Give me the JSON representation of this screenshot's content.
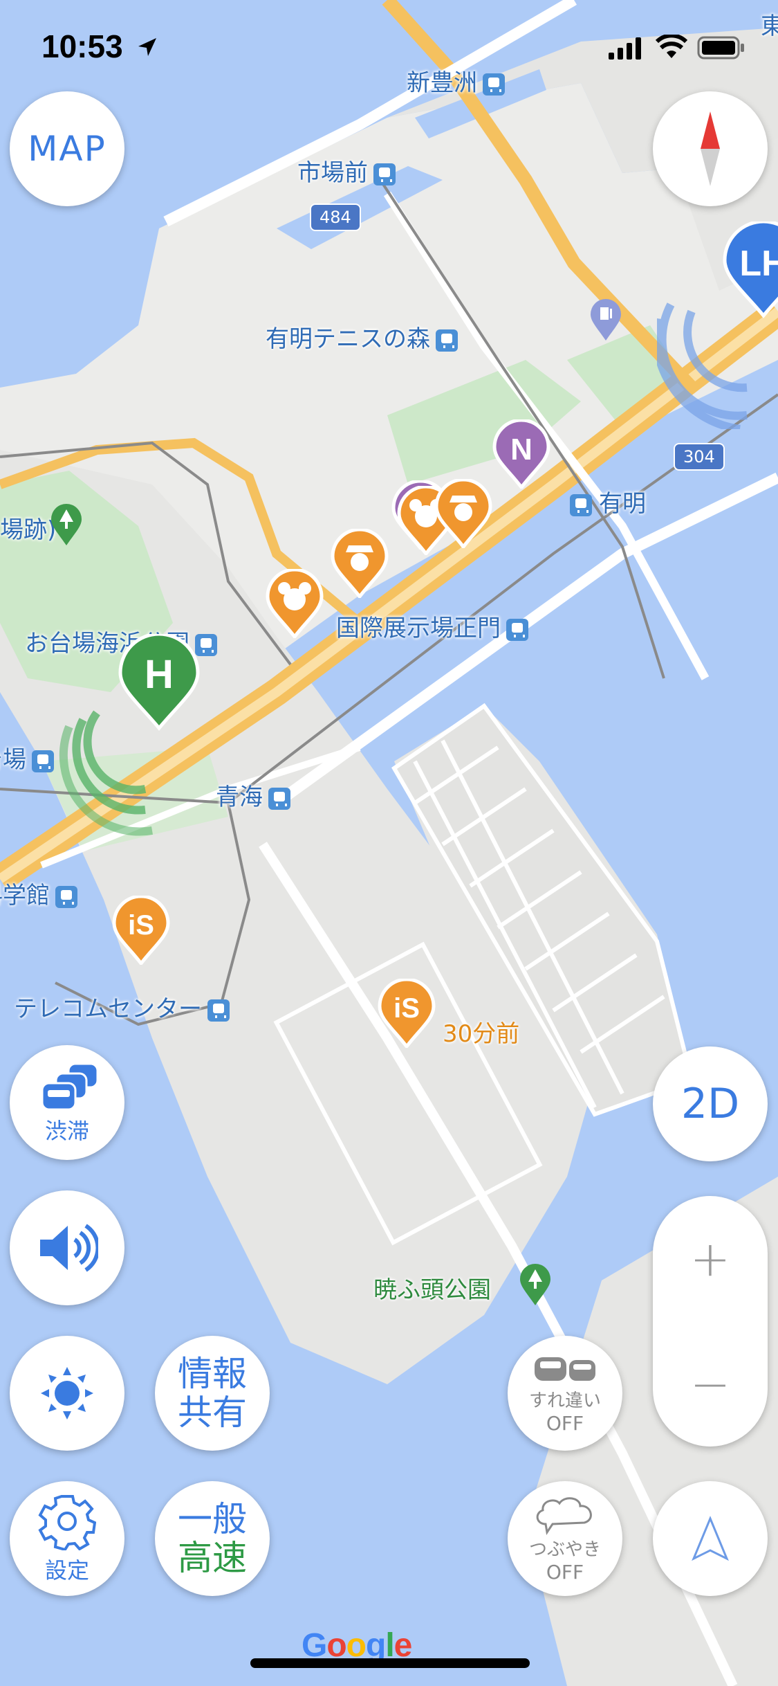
{
  "status_bar": {
    "time": "10:53"
  },
  "map_labels": {
    "shintoyosu": "新豊洲",
    "shijomae": "市場前",
    "route484": "484",
    "tennis": "有明テニスの森",
    "ariake": "有明",
    "route304": "304",
    "kokusai": "国際展示場正門",
    "odaiba_park": "お台場海浜公園",
    "aomi": "青海",
    "daiba": "台場",
    "science": "科学館",
    "telecom": "テレコムセンター",
    "park_partial": "場跡)",
    "ago": "30分前",
    "akatsuki": "暁ふ頭公園",
    "east_partial": "東"
  },
  "pins": {
    "h": "H",
    "n": "N",
    "lh": "LH",
    "is": "iS"
  },
  "buttons": {
    "map": "MAP",
    "traffic": "渋滞",
    "share_line1": "情報",
    "share_line2": "共有",
    "settings": "設定",
    "road_line1": "一般",
    "road_line2": "高速",
    "pass_label": "すれ違い",
    "pass_state": "OFF",
    "tweet_label": "つぶやき",
    "tweet_state": "OFF",
    "view_mode": "2D",
    "zoom_in": "+",
    "zoom_out": "−"
  },
  "colors": {
    "accent": "#3a7be0",
    "water": "#aecbf7",
    "highway": "#f6c66a",
    "pin_green": "#3e9a4a",
    "pin_orange": "#f0962e",
    "pin_purple": "#9b6bb5",
    "pin_blue": "#3a7be0"
  }
}
